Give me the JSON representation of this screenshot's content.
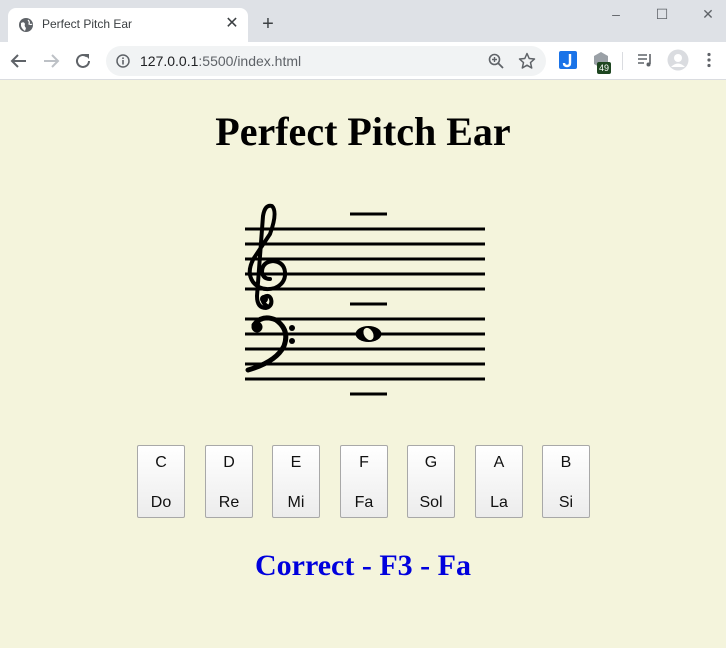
{
  "browser": {
    "tab_title": "Perfect Pitch Ear",
    "tab_icon": "globe-icon",
    "close_glyph": "✕",
    "newtab_glyph": "+",
    "url_host": "127.0.0.1",
    "url_rest": ":5500/index.html",
    "extension_badge": "49",
    "window_controls": {
      "minimize": "–",
      "maximize": "☐",
      "close": "✕"
    }
  },
  "page": {
    "title": "Perfect Pitch Ear",
    "background": "#f4f4dc",
    "result_text": "Correct - F3 - Fa",
    "result_color": "#0000dd"
  },
  "staff": {
    "clefs": [
      "treble",
      "bass"
    ],
    "note": "F3",
    "note_type": "whole"
  },
  "keys": [
    {
      "letter": "C",
      "solfege": "Do"
    },
    {
      "letter": "D",
      "solfege": "Re"
    },
    {
      "letter": "E",
      "solfege": "Mi"
    },
    {
      "letter": "F",
      "solfege": "Fa"
    },
    {
      "letter": "G",
      "solfege": "Sol"
    },
    {
      "letter": "A",
      "solfege": "La"
    },
    {
      "letter": "B",
      "solfege": "Si"
    }
  ]
}
